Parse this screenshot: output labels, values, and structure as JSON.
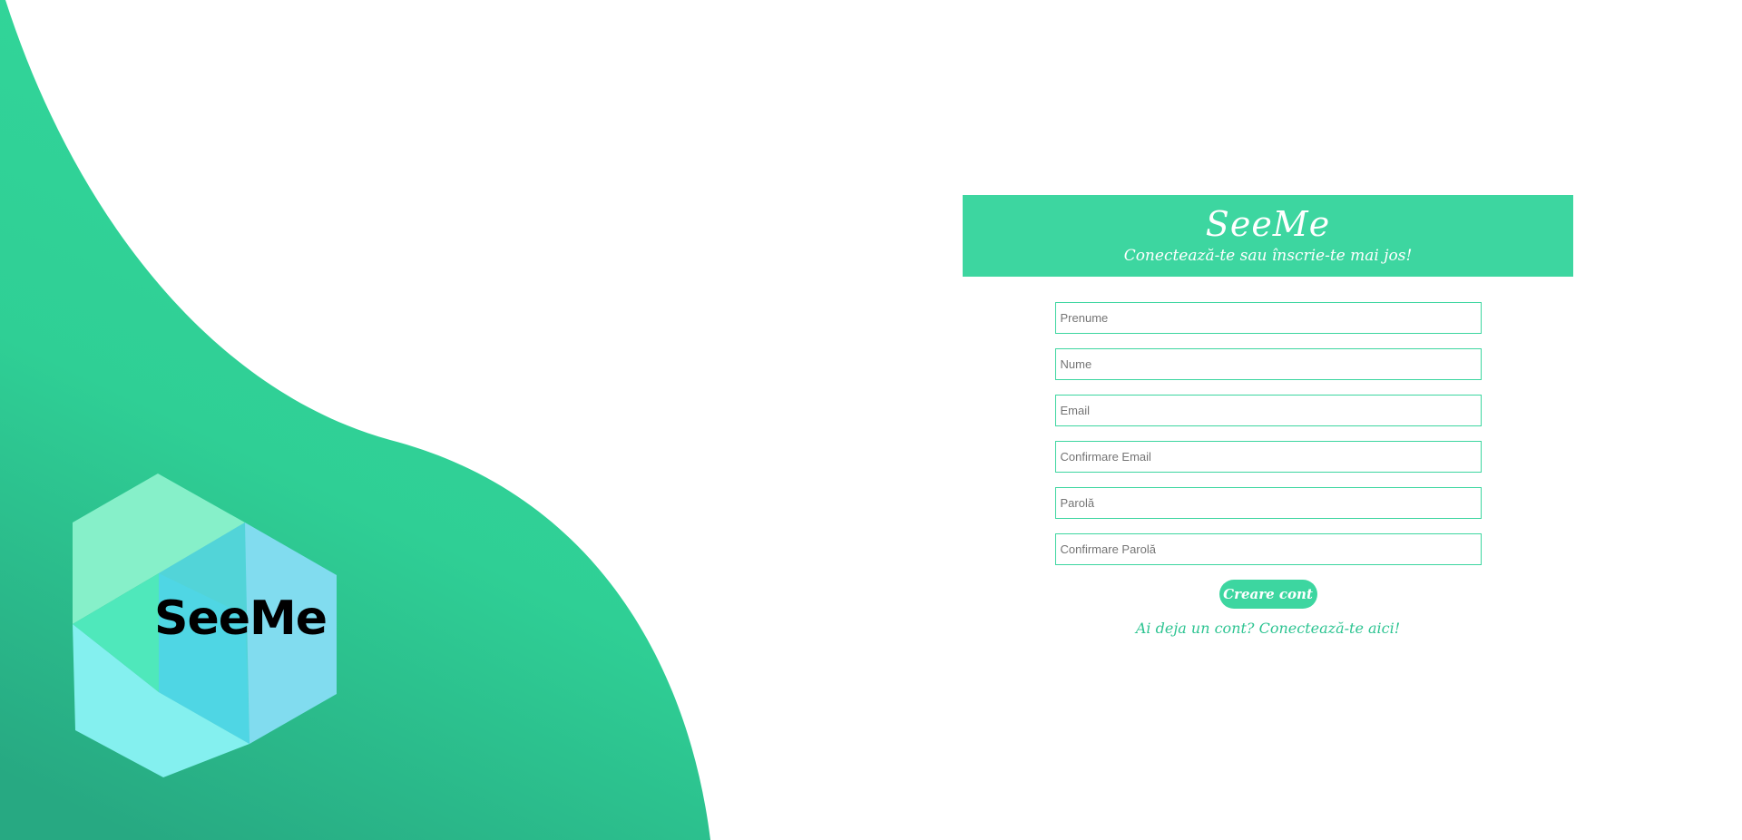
{
  "brand": {
    "logo_text": "SeeMe",
    "accent_color": "#3dd6a0",
    "gradient_top": "#34d89a",
    "gradient_bottom": "#29ad83"
  },
  "header": {
    "title": "SeeMe",
    "subtitle": "Conectează-te sau înscrie-te mai jos!"
  },
  "form": {
    "fields": [
      {
        "placeholder": "Prenume",
        "value": ""
      },
      {
        "placeholder": "Nume",
        "value": ""
      },
      {
        "placeholder": "Email",
        "value": ""
      },
      {
        "placeholder": "Confirmare Email",
        "value": ""
      },
      {
        "placeholder": "Parolă",
        "value": ""
      },
      {
        "placeholder": "Confirmare Parolă",
        "value": ""
      }
    ],
    "submit_label": "Creare cont",
    "login_link": "Ai deja un cont? Conectează-te aici!"
  }
}
